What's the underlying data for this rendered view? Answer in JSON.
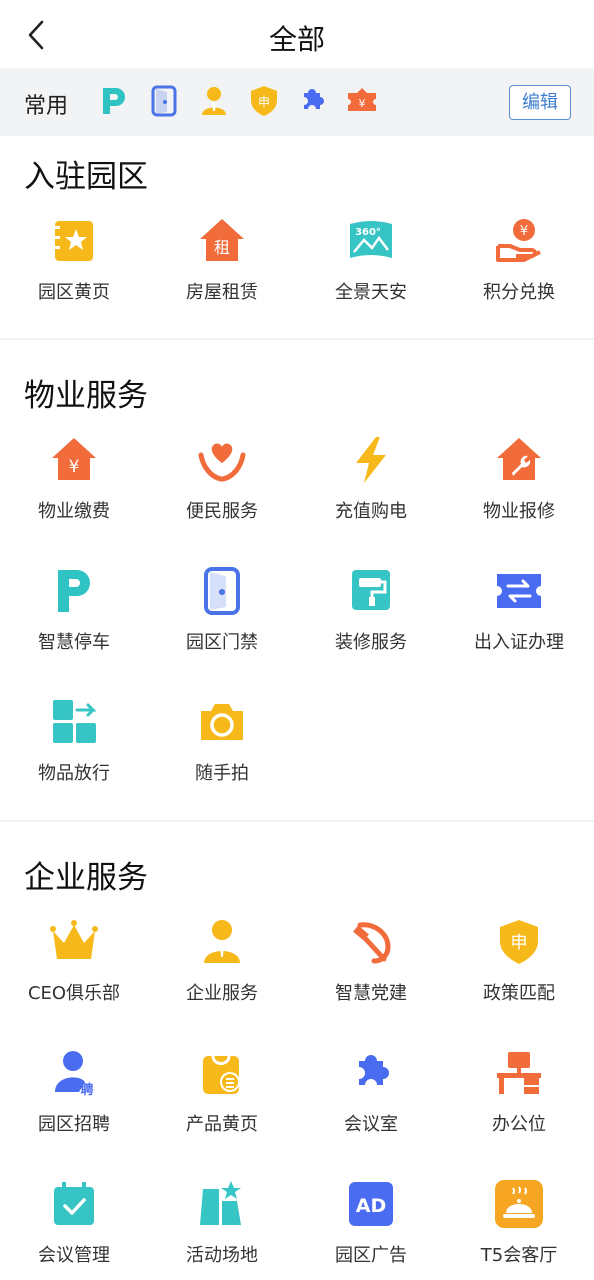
{
  "header": {
    "title": "全部",
    "back_icon": "chevron-left-icon"
  },
  "common": {
    "label": "常用",
    "edit_label": "编辑",
    "icons": [
      "parking-icon",
      "door-icon",
      "person-icon",
      "shield-icon",
      "puzzle-icon",
      "ticket-icon"
    ],
    "icon_text": {
      "shield": "申",
      "ticket": "¥"
    }
  },
  "sections": [
    {
      "title": "入驻园区",
      "items": [
        {
          "label": "园区黄页",
          "icon": "star-book-icon"
        },
        {
          "label": "房屋租赁",
          "icon": "house-rent-icon",
          "glyph": "租"
        },
        {
          "label": "全景天安",
          "icon": "panorama-360-icon",
          "glyph": "360°"
        },
        {
          "label": "积分兑换",
          "icon": "hand-coin-icon",
          "glyph": "¥"
        }
      ]
    },
    {
      "title": "物业服务",
      "items": [
        {
          "label": "物业缴费",
          "icon": "house-yuan-icon",
          "glyph": "¥"
        },
        {
          "label": "便民服务",
          "icon": "heart-hands-icon"
        },
        {
          "label": "充值购电",
          "icon": "lightning-icon"
        },
        {
          "label": "物业报修",
          "icon": "house-wrench-icon"
        },
        {
          "label": "智慧停车",
          "icon": "parking-icon"
        },
        {
          "label": "园区门禁",
          "icon": "door-icon"
        },
        {
          "label": "装修服务",
          "icon": "paint-roller-icon"
        },
        {
          "label": "出入证办理",
          "icon": "exchange-ticket-icon"
        },
        {
          "label": "物品放行",
          "icon": "blocks-arrow-icon"
        },
        {
          "label": "随手拍",
          "icon": "camera-icon"
        }
      ]
    },
    {
      "title": "企业服务",
      "items": [
        {
          "label": "CEO俱乐部",
          "icon": "crown-icon"
        },
        {
          "label": "企业服务",
          "icon": "businessman-icon"
        },
        {
          "label": "智慧党建",
          "icon": "hammer-sickle-icon"
        },
        {
          "label": "政策匹配",
          "icon": "shield-icon",
          "glyph": "申"
        },
        {
          "label": "园区招聘",
          "icon": "person-hire-icon",
          "glyph": "聘"
        },
        {
          "label": "产品黄页",
          "icon": "product-bag-icon"
        },
        {
          "label": "会议室",
          "icon": "puzzle-icon"
        },
        {
          "label": "办公位",
          "icon": "desk-icon"
        },
        {
          "label": "会议管理",
          "icon": "calendar-check-icon"
        },
        {
          "label": "活动场地",
          "icon": "venue-star-icon"
        },
        {
          "label": "园区广告",
          "icon": "ad-icon",
          "glyph": "AD"
        },
        {
          "label": "T5会客厅",
          "icon": "food-cover-icon"
        }
      ]
    }
  ]
}
